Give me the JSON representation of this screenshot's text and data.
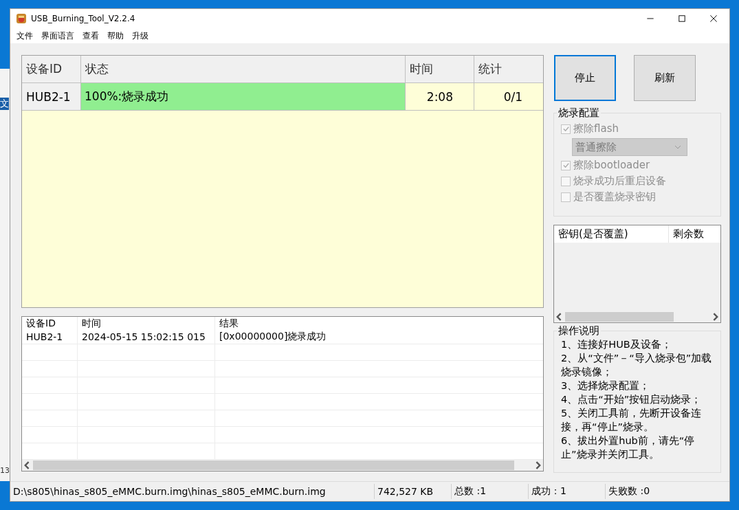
{
  "background_window": {
    "texts": [
      "文",
      "13"
    ]
  },
  "window": {
    "title": "USB_Burning_Tool_V2.2.4"
  },
  "menu": [
    "文件",
    "界面语言",
    "查看",
    "帮助",
    "升级"
  ],
  "device_table": {
    "columns": [
      "设备ID",
      "状态",
      "时间",
      "统计"
    ],
    "rows": [
      {
        "device_id": "HUB2-1",
        "status": "100%:烧录成功",
        "level": 1,
        "time": "2:08",
        "count": "0/1"
      }
    ]
  },
  "buttons": [
    {
      "label": "停止",
      "focused": true
    },
    {
      "label": "刷新",
      "focused": false
    }
  ],
  "burn_config": {
    "title": "烧录配置",
    "options": [
      {
        "kind": "checkbox",
        "label": "擦除flash",
        "checked": true,
        "disabled": true
      },
      {
        "kind": "select",
        "value": "普通擦除",
        "disabled": true
      },
      {
        "kind": "checkbox",
        "label": "擦除bootloader",
        "checked": true,
        "disabled": true
      },
      {
        "kind": "checkbox",
        "label": "烧录成功后重启设备",
        "checked": false,
        "disabled": true
      },
      {
        "kind": "checkbox",
        "label": "是否覆盖烧录密钥",
        "checked": false,
        "disabled": true
      }
    ]
  },
  "key_table": {
    "columns": [
      "密钥(是否覆盖)",
      "剩余数"
    ]
  },
  "instructions": {
    "title": "操作说明",
    "lines": [
      "1、连接好HUB及设备；",
      "2、从“文件”－“导入烧录包”加载烧录镜像；",
      "3、选择烧录配置；",
      "4、点击“开始”按钮启动烧录；",
      "5、关闭工具前，先断开设备连接，再“停止”烧录。",
      "6、拔出外置hub前，请先“停止”烧录并关闭工具。"
    ]
  },
  "log_table": {
    "columns": [
      "设备ID",
      "时间",
      "结果"
    ],
    "rows": [
      {
        "device_id": "HUB2-1",
        "time": "2024-05-15 15:02:15 015",
        "result": "[0x00000000]烧录成功"
      }
    ]
  },
  "status_bar": [
    "D:\\s805\\hinas_s805_eMMC.burn.img\\hinas_s805_eMMC.burn.img",
    "742,527 KB",
    "总数 :1",
    "成功：1",
    "失败数 :0"
  ]
}
